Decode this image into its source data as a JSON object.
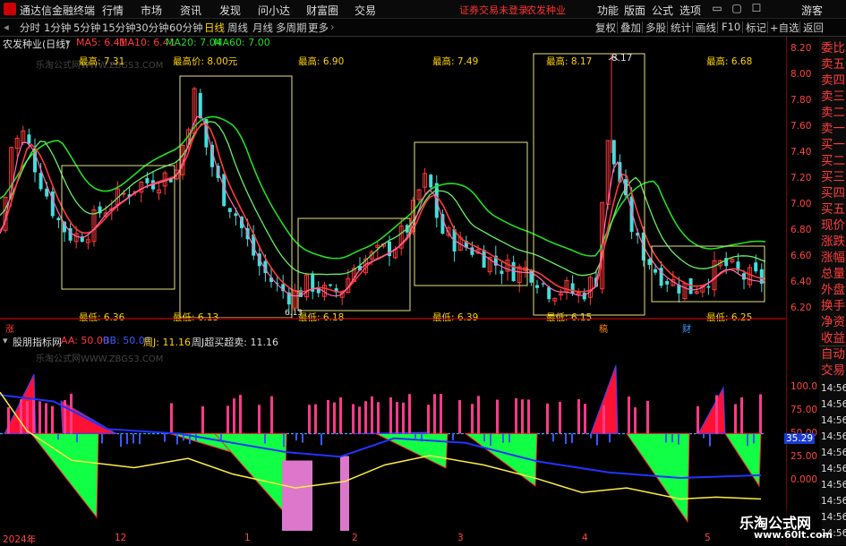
{
  "titlebar": {
    "app_name": "通达信金融终端",
    "menus": [
      "行情",
      "市场",
      "资讯",
      "发现",
      "问小达",
      "财富圈",
      "交易"
    ],
    "warning": "证券交易未登录",
    "stock_name": "农发种业",
    "right_menus": [
      "功能",
      "版面",
      "公式",
      "选项"
    ],
    "user": "游客"
  },
  "toolbar": {
    "periods": [
      "分时",
      "1分钟",
      "5分钟",
      "15分钟",
      "30分钟",
      "60分钟",
      "日线",
      "周线",
      "月线",
      "多周期",
      "更多"
    ],
    "active_period": "日线",
    "right_items": [
      "复权",
      "叠加",
      "多股",
      "统计",
      "画线",
      "F10",
      "标记",
      "+自选",
      "返回"
    ]
  },
  "legend": {
    "title": "农发种业(日线)",
    "ma5": "MA5: 6.41",
    "ma10": "MA10: 6.41",
    "ma20": "MA20: 7.04",
    "ma60": "MA60: 7.00",
    "colors": {
      "ma5": "#ff3a3a",
      "ma10": "#ff3a3a",
      "ma20": "#22dd22",
      "ma60": "#22dd22"
    }
  },
  "watermark": "乐淘公式网WWW.ZBGS3.COM",
  "annotations": {
    "highs": [
      "最高: 7.31",
      "最高价: 8.00元",
      "最高: 6.90",
      "最高: 7.49",
      "最高: 8.17",
      "8.17",
      "最高: 6.68"
    ],
    "lows": [
      "最低: 6.36",
      "最低: 6.13",
      "最低: 6.18",
      "最低: 6.39",
      "最低: 6.15",
      "最低: 6.25"
    ],
    "tags": [
      "涨",
      "稿",
      "财",
      "6.13"
    ]
  },
  "price_axis": [
    "8.20",
    "8.00",
    "7.80",
    "7.60",
    "7.40",
    "7.20",
    "7.00",
    "6.80",
    "6.60",
    "6.40",
    "6.20"
  ],
  "sidebar_top": [
    "委比",
    "卖五",
    "卖四",
    "卖三",
    "卖二",
    "卖一",
    "买一",
    "买二",
    "买三",
    "买四",
    "买五",
    "现价",
    "涨跌",
    "涨幅",
    "总量",
    "外盘",
    "换手",
    "净资",
    "收益"
  ],
  "sidebar_bottom": [
    "自动",
    "交易"
  ],
  "indicator": {
    "name": "股朋指标网",
    "aa": "AA: 50.00",
    "bb": "BB: 50.00",
    "cc": "周J: 11.16",
    "label": "周J超买超卖: 11.16",
    "value_tag": "35.29",
    "axis": [
      "100.0",
      "75.00",
      "50.00",
      "25.00",
      "0.000"
    ],
    "time_labels": [
      "14:56",
      "14:56",
      "14:56",
      "14:56",
      "14:56",
      "14:56",
      "14:56",
      "14:56",
      "14:56",
      "14:56"
    ]
  },
  "xaxis": [
    "2024年",
    "12",
    "1",
    "2",
    "3",
    "4",
    "5"
  ],
  "brand": {
    "name": "乐淘公式网",
    "url": "www.60lt.com"
  }
}
